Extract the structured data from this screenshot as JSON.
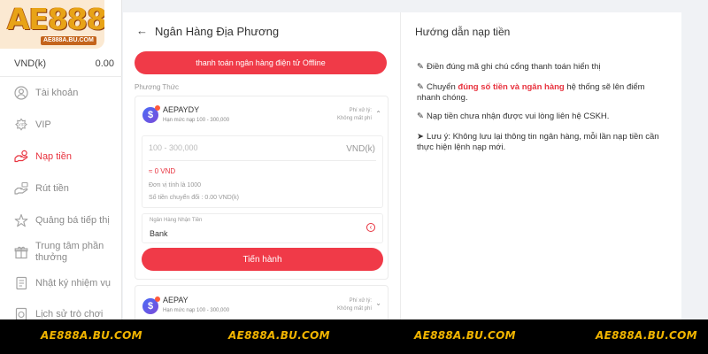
{
  "brand": {
    "logo": "AE888",
    "logo_sub": "AE888A.BU.COM"
  },
  "balance": {
    "currency": "VND(k)",
    "value": "0.00"
  },
  "sidebar": {
    "items": [
      {
        "label": "Tài khoản",
        "icon": "user-icon"
      },
      {
        "label": "VIP",
        "icon": "vip-icon"
      },
      {
        "label": "Nạp tiền",
        "icon": "deposit-icon",
        "active": true
      },
      {
        "label": "Rút tiền",
        "icon": "withdraw-icon"
      },
      {
        "label": "Quảng bá tiếp thị",
        "icon": "promote-icon"
      },
      {
        "label": "Trung tâm phần thưởng",
        "icon": "reward-icon"
      },
      {
        "label": "Nhật ký nhiệm vụ",
        "icon": "task-icon"
      },
      {
        "label": "Lịch sử trò chơi",
        "icon": "history-icon"
      }
    ]
  },
  "deposit": {
    "title": "Ngân Hàng Địa Phương",
    "offline_button": "thanh toán ngân hàng điện tử Offline",
    "method_label": "Phương Thức",
    "methods": [
      {
        "name": "AEPAYDY",
        "limit": "Hạn mức nạp 100 - 300,000",
        "fee_line1": "Phí xử lý:",
        "fee_line2": "Không mất phí"
      },
      {
        "name": "AEPAY",
        "limit": "Hạn mức nạp 100 - 300,000",
        "fee_line1": "Phí xử lý:",
        "fee_line2": "Không mất phí"
      }
    ],
    "amount_placeholder": "100 - 300,000",
    "amount_unit": "VND(k)",
    "converted": "≈ 0 VND",
    "unit_note": "Đơn vị tính là 1000",
    "transfer_note": "Số tiền chuyển đổi : 0.00 VND(k)",
    "bank_label": "Ngân Hàng Nhận Tiền",
    "bank_value": "Bank",
    "proceed_button": "Tiến hành"
  },
  "guide": {
    "title": "Hướng dẫn nạp tiền",
    "item1": "Điền đúng mã ghi chú cổng thanh toán hiển thị",
    "item2_pre": "Chuyển ",
    "item2_hl": "đúng số tiền và ngân hàng",
    "item2_post": " hệ thống sẽ lên điểm nhanh chóng.",
    "item3": "Nạp tiền chưa nhận được vui lòng liên hệ CSKH.",
    "item4": "Lưu ý: Không lưu lại thông tin ngân hàng, mỗi lần nạp tiền cần thực hiện lệnh nạp mới."
  },
  "footer": {
    "url": "AE888A.BU.COM"
  },
  "colors": {
    "accent": "#f03a48",
    "footer_text": "#f0b400"
  }
}
